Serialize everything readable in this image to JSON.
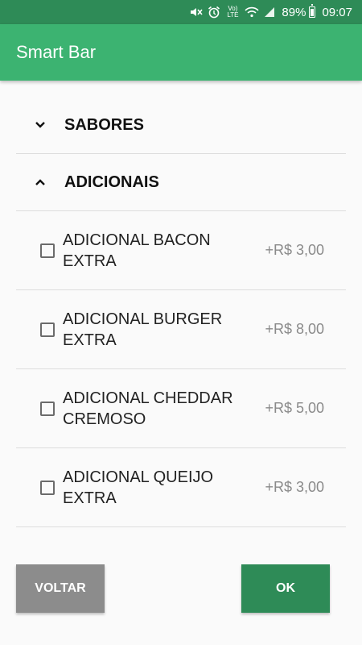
{
  "status_bar": {
    "battery": "89%",
    "time": "09:07",
    "network_label": "Vo) LTE"
  },
  "app_bar": {
    "title": "Smart Bar"
  },
  "groups": [
    {
      "label": "SABORES",
      "icon": "chevron-down-icon"
    },
    {
      "label": "ADICIONAIS",
      "icon": "chevron-up-icon"
    }
  ],
  "items": [
    {
      "name": "ADICIONAL BACON EXTRA",
      "price": "+R$ 3,00",
      "checked": false
    },
    {
      "name": "ADICIONAL BURGER EXTRA",
      "price": "+R$ 8,00",
      "checked": false
    },
    {
      "name": "ADICIONAL CHEDDAR CREMOSO",
      "price": "+R$ 5,00",
      "checked": false
    },
    {
      "name": "ADICIONAL QUEIJO EXTRA",
      "price": "+R$ 3,00",
      "checked": false
    }
  ],
  "buttons": {
    "back": "VOLTAR",
    "ok": "OK"
  },
  "colors": {
    "status_bar": "#2e8b57",
    "app_bar": "#3cb371",
    "ok_button": "#2e8b57",
    "back_button": "#8c8c8c"
  }
}
